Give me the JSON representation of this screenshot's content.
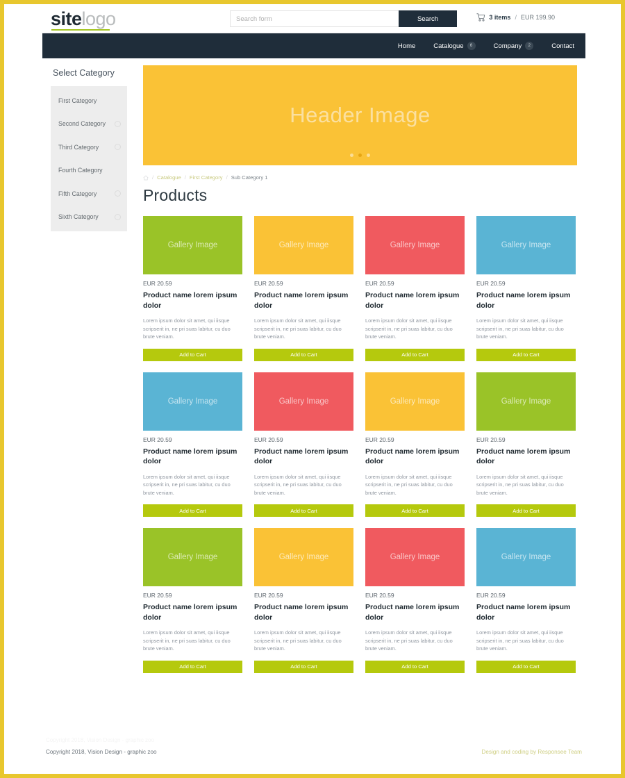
{
  "header": {
    "logo_strong": "site",
    "logo_light": "logo",
    "search_placeholder": "Search form",
    "search_value": "",
    "search_button": "Search",
    "cart_icon": "shopping-cart-icon",
    "cart_count": "3 items",
    "cart_separator": "/",
    "cart_total": "EUR 199.90"
  },
  "nav": {
    "items": [
      {
        "label": "Home",
        "badge": ""
      },
      {
        "label": "Catalogue",
        "badge": "6"
      },
      {
        "label": "Company",
        "badge": "2"
      },
      {
        "label": "Contact",
        "badge": ""
      }
    ]
  },
  "sidebar": {
    "title": "Select Category",
    "items": [
      {
        "label": "First Category",
        "has_icon": false
      },
      {
        "label": "Second Category",
        "has_icon": true
      },
      {
        "label": "Third Category",
        "has_icon": true
      },
      {
        "label": "Fourth Category",
        "has_icon": false
      },
      {
        "label": "Fifth Category",
        "has_icon": true
      },
      {
        "label": "Sixth Category",
        "has_icon": true
      }
    ]
  },
  "hero": {
    "text": "Header Image",
    "background": "#fac236",
    "dots": [
      {
        "active": false
      },
      {
        "active": true
      },
      {
        "active": false
      }
    ]
  },
  "breadcrumb": {
    "home_icon": "home-icon",
    "items": [
      {
        "label": "Catalogue",
        "current": false
      },
      {
        "label": "First Category",
        "current": false
      },
      {
        "label": "Sub Category 1",
        "current": true
      }
    ],
    "separator": "/"
  },
  "main": {
    "page_title": "Products"
  },
  "products": {
    "thumb_label": "Gallery Image",
    "price": "EUR 20.59",
    "name": "Product name lorem ipsum dolor",
    "description": "Lorem ipsum dolor sit amet, qui iisque scripserit in, ne pri suas labitur, cu duo brute veniam.",
    "button_label": "Add to Cart",
    "colors": {
      "green": "#9ac328",
      "yellow": "#fac236",
      "red": "#f05a5f",
      "blue": "#5ab4d4"
    },
    "items": [
      {
        "color": "#9ac328",
        "color_name": "green"
      },
      {
        "color": "#fac236",
        "color_name": "yellow"
      },
      {
        "color": "#f05a5f",
        "color_name": "red"
      },
      {
        "color": "#5ab4d4",
        "color_name": "blue"
      },
      {
        "color": "#5ab4d4",
        "color_name": "blue"
      },
      {
        "color": "#f05a5f",
        "color_name": "red"
      },
      {
        "color": "#fac236",
        "color_name": "yellow"
      },
      {
        "color": "#9ac328",
        "color_name": "green"
      },
      {
        "color": "#9ac328",
        "color_name": "green"
      },
      {
        "color": "#fac236",
        "color_name": "yellow"
      },
      {
        "color": "#f05a5f",
        "color_name": "red"
      },
      {
        "color": "#5ab4d4",
        "color_name": "blue"
      }
    ]
  },
  "footer": {
    "ghost_text": "Copyright 2018, Vision Design - graphic zoo",
    "copyright": "Copyright 2018, Vision Design - graphic zoo",
    "credit": "Design and coding by Responsee Team"
  },
  "theme": {
    "frame": "#e8c72e",
    "navbar": "#1f2d3a",
    "accent_green": "#b5c90d",
    "logo_underline": "#a3c421"
  }
}
